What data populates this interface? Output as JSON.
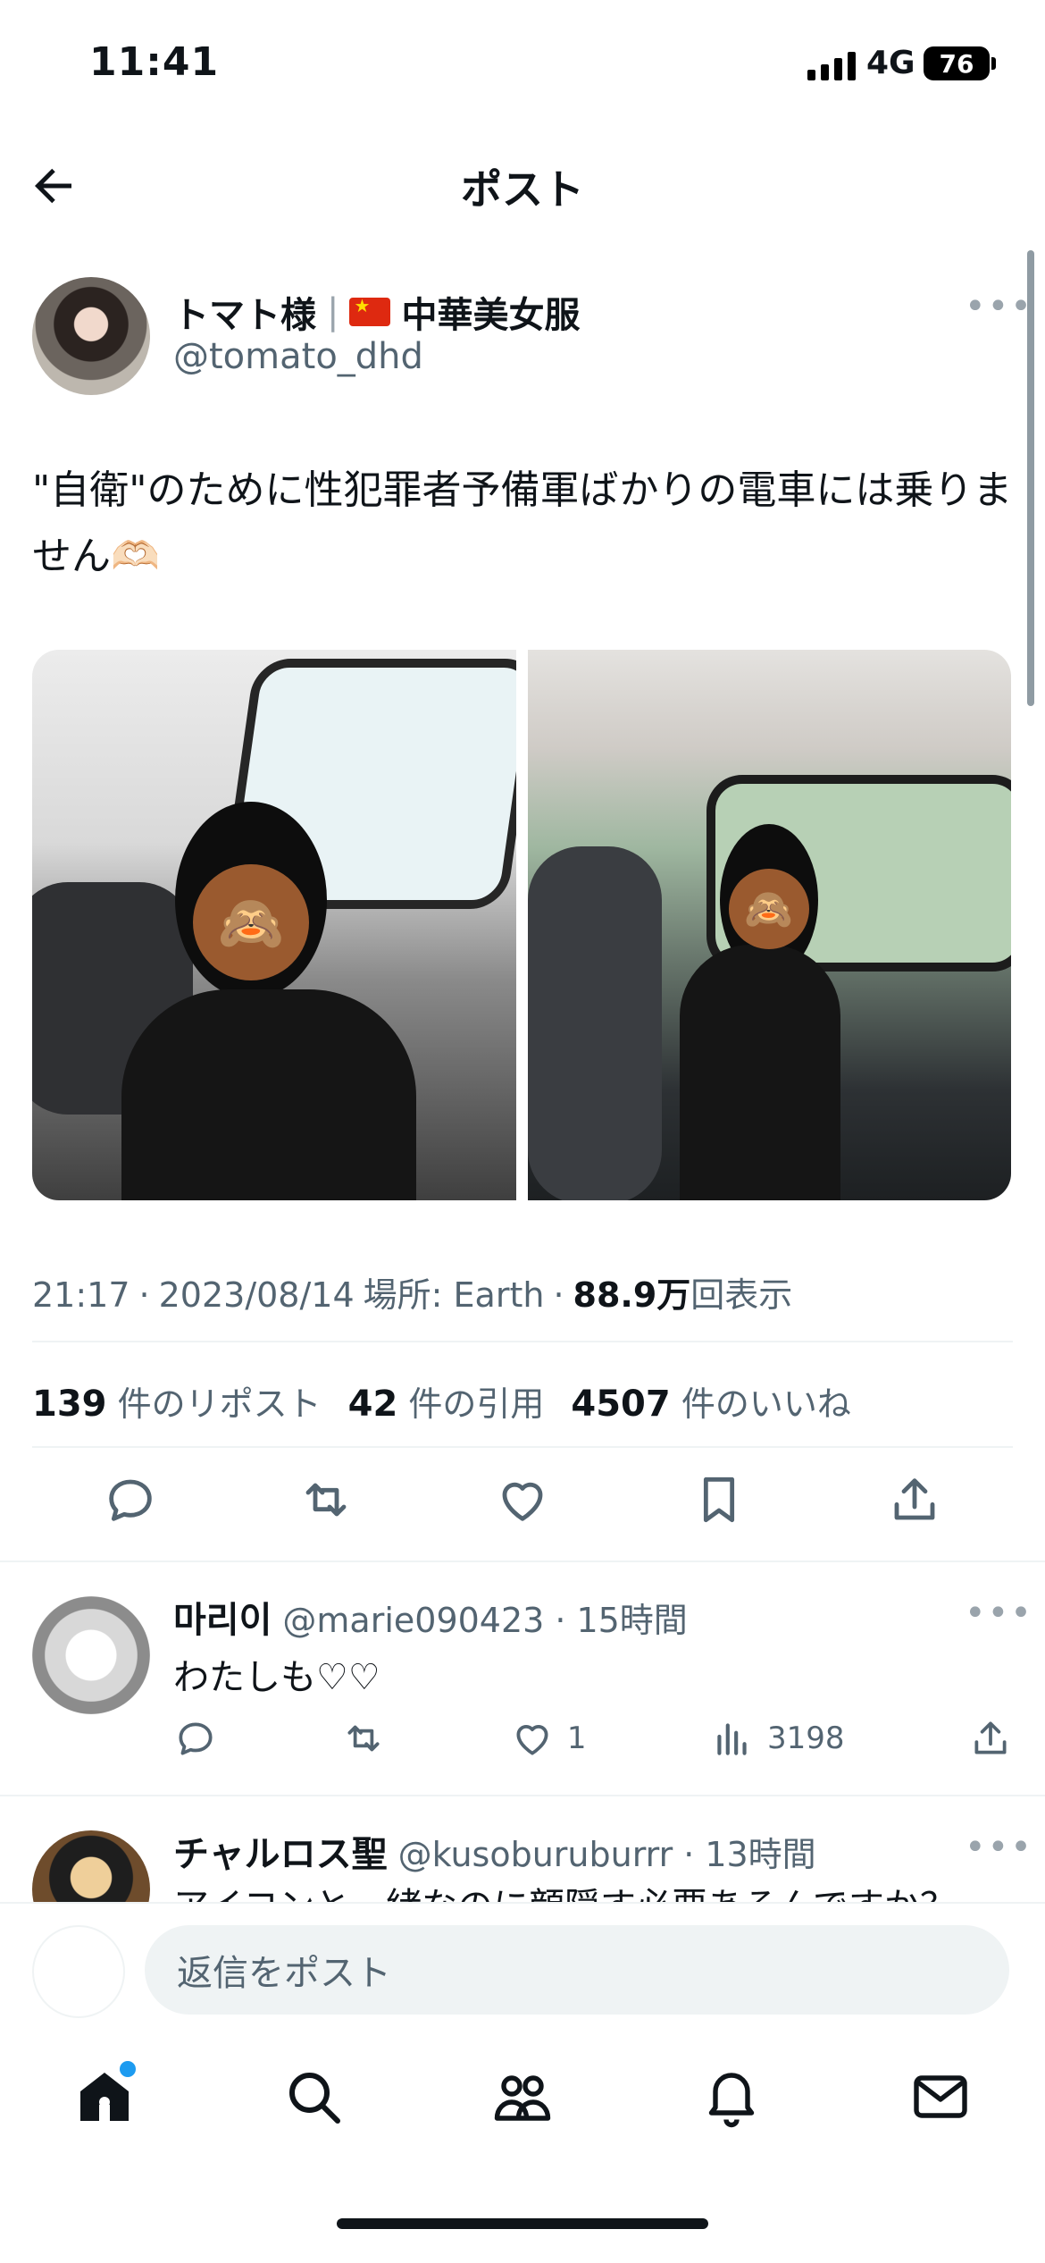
{
  "status_bar": {
    "time": "11:41",
    "network": "4G",
    "battery": "76"
  },
  "header": {
    "title": "ポスト"
  },
  "tweet": {
    "author_name": "トマト様",
    "author_separator": "|",
    "author_suffix": "中華美女服",
    "handle": "@tomato_dhd",
    "text": "\"自衛\"のために性犯罪者予備軍ばかりの電車には乗りません🫶🏻",
    "meta": {
      "time": "21:17",
      "dot1": "·",
      "date": "2023/08/14",
      "place": "場所: Earth",
      "dot2": "·",
      "views_value": "88.9万",
      "views_label": "回表示"
    },
    "stats": {
      "reposts_value": "139",
      "reposts_label": "件のリポスト",
      "quotes_value": "42",
      "quotes_label": "件の引用",
      "likes_value": "4507",
      "likes_label": "件のいいね"
    }
  },
  "replies": [
    {
      "name": "마리이",
      "handle": "@marie090423",
      "dot": "·",
      "time": "15時間",
      "text": "わたしも♡♡",
      "likes": "1",
      "views": "3198"
    },
    {
      "name": "チャルロス聖",
      "handle": "@kusoburuburrr",
      "dot": "·",
      "time": "13時間",
      "text": "アイコンと一緒なのに顔隠す必要あるんですか？"
    }
  ],
  "composer": {
    "placeholder": "返信をポスト"
  },
  "colors": {
    "accent": "#1d9bf0",
    "text": "#0f1419",
    "secondary": "#536471",
    "divider": "#eff3f4"
  },
  "icons": [
    "back-arrow-icon",
    "reply-icon",
    "repost-icon",
    "like-icon",
    "bookmark-icon",
    "share-icon",
    "views-icon",
    "home-icon",
    "search-icon",
    "communities-icon",
    "notifications-icon",
    "messages-icon"
  ]
}
